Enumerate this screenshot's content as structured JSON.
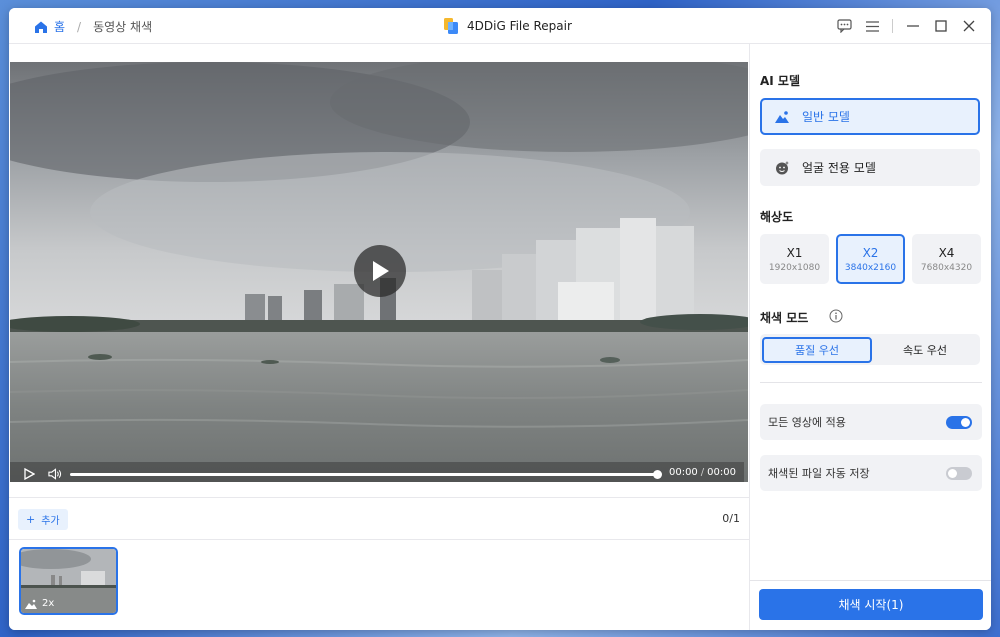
{
  "breadcrumb": {
    "home": "홈",
    "separator": "/",
    "current": "동영상 채색"
  },
  "app": {
    "title": "4DDiG File Repair"
  },
  "icons": {
    "home": "home-icon",
    "logo": "app-logo-icon",
    "feedback": "feedback-icon",
    "menu": "menu-icon",
    "minimize": "minimize-icon",
    "maximize": "maximize-icon",
    "close": "close-icon",
    "play": "play-icon",
    "volume": "volume-icon",
    "image": "image-icon",
    "face": "face-icon",
    "info": "info-icon"
  },
  "colors": {
    "accent": "#2a73e8",
    "accent_bg": "#e8f1fd",
    "panel_bg": "#f1f2f5"
  },
  "player": {
    "current_time": "00:00",
    "time_separator": "/",
    "total_time": "00:00",
    "progress_percent": 100
  },
  "list": {
    "add_label": "추가",
    "add_prefix": "+",
    "count": "0/1"
  },
  "thumbnail": {
    "badge": "2x"
  },
  "panel": {
    "ai_model_title": "AI 모델",
    "models": [
      {
        "label": "일반 모델",
        "selected": true
      },
      {
        "label": "얼굴 전용 모델",
        "selected": false
      }
    ],
    "resolution_title": "해상도",
    "resolutions": [
      {
        "name": "X1",
        "size": "1920x1080",
        "selected": false
      },
      {
        "name": "X2",
        "size": "3840x2160",
        "selected": true
      },
      {
        "name": "X4",
        "size": "7680x4320",
        "selected": false
      }
    ],
    "mode_title": "채색 모드",
    "modes": [
      {
        "label": "품질 우선",
        "selected": true
      },
      {
        "label": "속도 우선",
        "selected": false
      }
    ],
    "apply_all_label": "모든 영상에 적용",
    "apply_all_on": true,
    "auto_save_label": "채색된 파일 자동 저장",
    "auto_save_on": false,
    "start_label": "채색 시작(1)"
  }
}
